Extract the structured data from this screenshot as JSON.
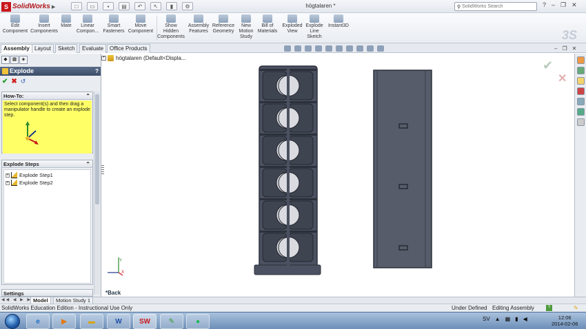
{
  "app": {
    "name": "SolidWorks",
    "doc_title": "högtalaren *",
    "search_placeholder": "SolidWorks Search"
  },
  "ribbon": {
    "buttons": [
      {
        "label": "Edit\nComponent"
      },
      {
        "label": "Insert\nComponents"
      },
      {
        "label": "Mate"
      },
      {
        "label": "Linear\nCompon..."
      },
      {
        "label": "Smart\nFasteners"
      },
      {
        "label": "Move\nComponent"
      },
      {
        "label": "Show\nHidden\nComponents"
      },
      {
        "label": "Assembly\nFeatures"
      },
      {
        "label": "Reference\nGeometry"
      },
      {
        "label": "New\nMotion\nStudy"
      },
      {
        "label": "Bill of\nMaterials"
      },
      {
        "label": "Exploded\nView"
      },
      {
        "label": "Explode\nLine\nSketch"
      },
      {
        "label": "Instant3D"
      }
    ]
  },
  "tabs": [
    "Assembly",
    "Layout",
    "Sketch",
    "Evaluate",
    "Office Products"
  ],
  "property_manager": {
    "title": "Explode",
    "help": "?",
    "howto_header": "How-To:",
    "howto_text": "Select component(s) and then drag a manipulator handle to create an explode step.",
    "steps_header": "Explode Steps",
    "steps": [
      "Explode Step1",
      "Explode Step2"
    ],
    "settings_header": "Settings"
  },
  "viewport": {
    "tree_root": "högtalaren  (Default<Displa...",
    "back_label": "*Back"
  },
  "bottom_tabs": [
    "Model",
    "Motion Study 1"
  ],
  "status": {
    "left": "SolidWorks Education Edition - Instructional Use Only",
    "defined": "Under Defined",
    "mode": "Editing Assembly"
  },
  "taskbar": {
    "lang": "SV",
    "time": "12:06",
    "date": "2014-02-06"
  },
  "colors": {
    "accent": "#c8171c",
    "howto_bg": "#ffff66",
    "model_dark": "#4b5160",
    "model_panel": "#575c6b"
  }
}
